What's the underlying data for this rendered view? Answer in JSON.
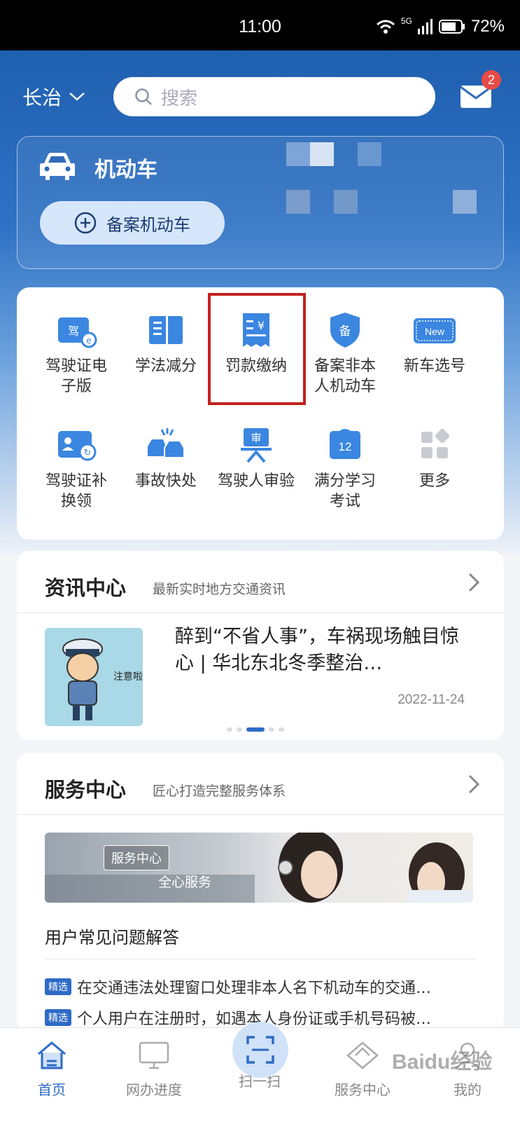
{
  "status": {
    "time": "11:00",
    "network": "5G",
    "battery": "72%"
  },
  "topbar": {
    "city": "长治",
    "search_placeholder": "搜索",
    "mail_badge": "2"
  },
  "vehicle": {
    "title": "机动车",
    "file_button": "备案机动车"
  },
  "grid": [
    {
      "label": "驾驶证电\n子版",
      "icon": "driver-license-e-icon"
    },
    {
      "label": "学法减分",
      "icon": "book-icon"
    },
    {
      "label": "罚款缴纳",
      "icon": "fine-receipt-icon"
    },
    {
      "label": "备案非本\n人机动车",
      "icon": "shield-file-icon"
    },
    {
      "label": "新车选号",
      "icon": "new-plate-icon"
    },
    {
      "label": "驾驶证补\n换领",
      "icon": "license-renew-icon"
    },
    {
      "label": "事故快处",
      "icon": "accident-icon"
    },
    {
      "label": "驾驶人审验",
      "icon": "review-icon"
    },
    {
      "label": "满分学习\n考试",
      "icon": "calendar-12-icon"
    },
    {
      "label": "更多",
      "icon": "more-apps-icon"
    }
  ],
  "news": {
    "title": "资讯中心",
    "subtitle": "最新实时地方交通资讯",
    "item_title": "醉到“不省人事”，车祸现场触目惊心 | 华北东北冬季整治…",
    "item_date": "2022-11-24",
    "image_caption": "注意啦!"
  },
  "service": {
    "title": "服务中心",
    "subtitle": "匠心打造完整服务体系",
    "banner_tag": "服务中心",
    "banner_text": "全心服务",
    "faq_title": "用户常见问题解答",
    "faq_tag": "精选",
    "faqs": [
      "在交通违法处理窗口处理非本人名下机动车的交通…",
      "个人用户在注册时，如遇本人身份证或手机号码被…"
    ]
  },
  "tabs": [
    {
      "label": "首页",
      "icon": "home-icon"
    },
    {
      "label": "网办进度",
      "icon": "monitor-icon"
    },
    {
      "label": "扫一扫",
      "icon": "scan-icon"
    },
    {
      "label": "服务中心",
      "icon": "service-icon"
    },
    {
      "label": "我的",
      "icon": "profile-icon"
    }
  ],
  "watermark": "Baidu经验",
  "colors": {
    "primary": "#2e6bc6",
    "highlight": "#c3211e",
    "badge": "#e94a45"
  }
}
